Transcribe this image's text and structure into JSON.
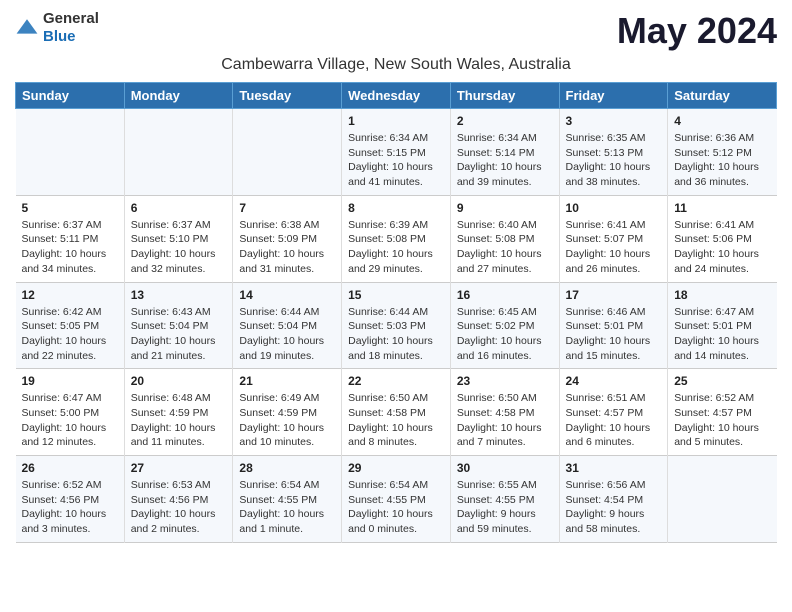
{
  "logo": {
    "general": "General",
    "blue": "Blue"
  },
  "title": "May 2024",
  "location": "Cambewarra Village, New South Wales, Australia",
  "days_of_week": [
    "Sunday",
    "Monday",
    "Tuesday",
    "Wednesday",
    "Thursday",
    "Friday",
    "Saturday"
  ],
  "weeks": [
    [
      {
        "day": "",
        "info": ""
      },
      {
        "day": "",
        "info": ""
      },
      {
        "day": "",
        "info": ""
      },
      {
        "day": "1",
        "info": "Sunrise: 6:34 AM\nSunset: 5:15 PM\nDaylight: 10 hours\nand 41 minutes."
      },
      {
        "day": "2",
        "info": "Sunrise: 6:34 AM\nSunset: 5:14 PM\nDaylight: 10 hours\nand 39 minutes."
      },
      {
        "day": "3",
        "info": "Sunrise: 6:35 AM\nSunset: 5:13 PM\nDaylight: 10 hours\nand 38 minutes."
      },
      {
        "day": "4",
        "info": "Sunrise: 6:36 AM\nSunset: 5:12 PM\nDaylight: 10 hours\nand 36 minutes."
      }
    ],
    [
      {
        "day": "5",
        "info": "Sunrise: 6:37 AM\nSunset: 5:11 PM\nDaylight: 10 hours\nand 34 minutes."
      },
      {
        "day": "6",
        "info": "Sunrise: 6:37 AM\nSunset: 5:10 PM\nDaylight: 10 hours\nand 32 minutes."
      },
      {
        "day": "7",
        "info": "Sunrise: 6:38 AM\nSunset: 5:09 PM\nDaylight: 10 hours\nand 31 minutes."
      },
      {
        "day": "8",
        "info": "Sunrise: 6:39 AM\nSunset: 5:08 PM\nDaylight: 10 hours\nand 29 minutes."
      },
      {
        "day": "9",
        "info": "Sunrise: 6:40 AM\nSunset: 5:08 PM\nDaylight: 10 hours\nand 27 minutes."
      },
      {
        "day": "10",
        "info": "Sunrise: 6:41 AM\nSunset: 5:07 PM\nDaylight: 10 hours\nand 26 minutes."
      },
      {
        "day": "11",
        "info": "Sunrise: 6:41 AM\nSunset: 5:06 PM\nDaylight: 10 hours\nand 24 minutes."
      }
    ],
    [
      {
        "day": "12",
        "info": "Sunrise: 6:42 AM\nSunset: 5:05 PM\nDaylight: 10 hours\nand 22 minutes."
      },
      {
        "day": "13",
        "info": "Sunrise: 6:43 AM\nSunset: 5:04 PM\nDaylight: 10 hours\nand 21 minutes."
      },
      {
        "day": "14",
        "info": "Sunrise: 6:44 AM\nSunset: 5:04 PM\nDaylight: 10 hours\nand 19 minutes."
      },
      {
        "day": "15",
        "info": "Sunrise: 6:44 AM\nSunset: 5:03 PM\nDaylight: 10 hours\nand 18 minutes."
      },
      {
        "day": "16",
        "info": "Sunrise: 6:45 AM\nSunset: 5:02 PM\nDaylight: 10 hours\nand 16 minutes."
      },
      {
        "day": "17",
        "info": "Sunrise: 6:46 AM\nSunset: 5:01 PM\nDaylight: 10 hours\nand 15 minutes."
      },
      {
        "day": "18",
        "info": "Sunrise: 6:47 AM\nSunset: 5:01 PM\nDaylight: 10 hours\nand 14 minutes."
      }
    ],
    [
      {
        "day": "19",
        "info": "Sunrise: 6:47 AM\nSunset: 5:00 PM\nDaylight: 10 hours\nand 12 minutes."
      },
      {
        "day": "20",
        "info": "Sunrise: 6:48 AM\nSunset: 4:59 PM\nDaylight: 10 hours\nand 11 minutes."
      },
      {
        "day": "21",
        "info": "Sunrise: 6:49 AM\nSunset: 4:59 PM\nDaylight: 10 hours\nand 10 minutes."
      },
      {
        "day": "22",
        "info": "Sunrise: 6:50 AM\nSunset: 4:58 PM\nDaylight: 10 hours\nand 8 minutes."
      },
      {
        "day": "23",
        "info": "Sunrise: 6:50 AM\nSunset: 4:58 PM\nDaylight: 10 hours\nand 7 minutes."
      },
      {
        "day": "24",
        "info": "Sunrise: 6:51 AM\nSunset: 4:57 PM\nDaylight: 10 hours\nand 6 minutes."
      },
      {
        "day": "25",
        "info": "Sunrise: 6:52 AM\nSunset: 4:57 PM\nDaylight: 10 hours\nand 5 minutes."
      }
    ],
    [
      {
        "day": "26",
        "info": "Sunrise: 6:52 AM\nSunset: 4:56 PM\nDaylight: 10 hours\nand 3 minutes."
      },
      {
        "day": "27",
        "info": "Sunrise: 6:53 AM\nSunset: 4:56 PM\nDaylight: 10 hours\nand 2 minutes."
      },
      {
        "day": "28",
        "info": "Sunrise: 6:54 AM\nSunset: 4:55 PM\nDaylight: 10 hours\nand 1 minute."
      },
      {
        "day": "29",
        "info": "Sunrise: 6:54 AM\nSunset: 4:55 PM\nDaylight: 10 hours\nand 0 minutes."
      },
      {
        "day": "30",
        "info": "Sunrise: 6:55 AM\nSunset: 4:55 PM\nDaylight: 9 hours\nand 59 minutes."
      },
      {
        "day": "31",
        "info": "Sunrise: 6:56 AM\nSunset: 4:54 PM\nDaylight: 9 hours\nand 58 minutes."
      },
      {
        "day": "",
        "info": ""
      }
    ]
  ]
}
